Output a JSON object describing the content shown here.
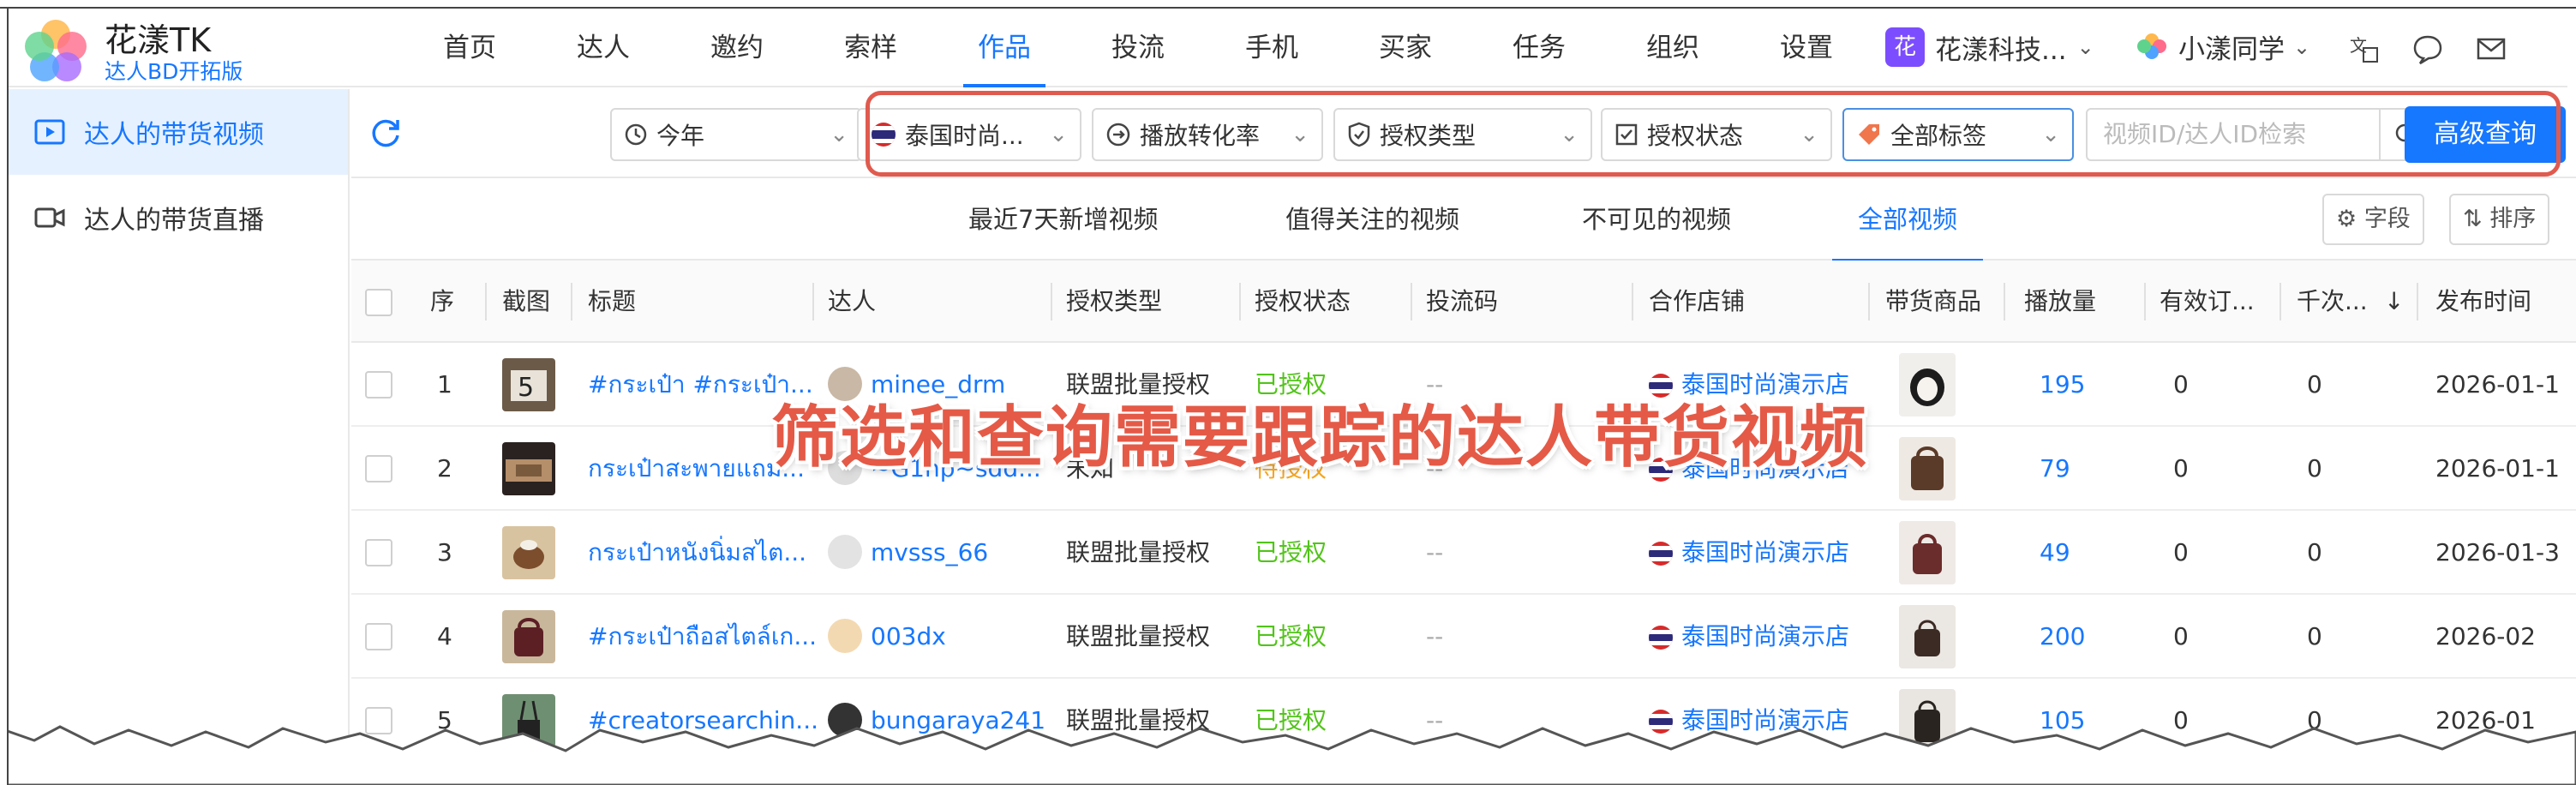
{
  "app": {
    "name": "花漾TK",
    "subtitle": "达人BD开拓版"
  },
  "nav": {
    "items": [
      "首页",
      "达人",
      "邀约",
      "索样",
      "作品",
      "投流",
      "手机",
      "买家",
      "任务",
      "组织",
      "设置"
    ],
    "active_index": 4,
    "org_badge": "花",
    "org_name": "花漾科技...",
    "user_name": "小漾同学"
  },
  "sidebar": {
    "items": [
      {
        "label": "达人的带货视频",
        "active": true
      },
      {
        "label": "达人的带货直播",
        "active": false
      }
    ]
  },
  "filters": {
    "time": "今年",
    "shop": "泰国时尚...",
    "metric": "播放转化率",
    "auth_type": "授权类型",
    "auth_status": "授权状态",
    "tags": "全部标签",
    "search_placeholder": "视频ID/达人ID检索",
    "advanced": "高级查询"
  },
  "tabs": {
    "items": [
      "最近7天新增视频",
      "值得关注的视频",
      "不可见的视频",
      "全部视频"
    ],
    "active_index": 3,
    "fields_btn": "字段",
    "sort_btn": "排序"
  },
  "table": {
    "headers": {
      "seq": "序",
      "shot": "截图",
      "title": "标题",
      "creator": "达人",
      "auth_type": "授权类型",
      "auth_status": "授权状态",
      "ad_code": "投流码",
      "shop": "合作店铺",
      "product": "带货商品",
      "plays": "播放量",
      "orders": "有效订...",
      "per_k": "千次...",
      "published": "发布时间"
    },
    "rows": [
      {
        "seq": "1",
        "title": "#กระเป๋า #กระเป๋า...",
        "creator": "minee_drm",
        "auth_type": "联盟批量授权",
        "auth_status": "已授权",
        "ad_code": "--",
        "shop": "泰国时尚演示店",
        "plays": "195",
        "orders": "0",
        "per_k": "0",
        "published": "2026-01-1"
      },
      {
        "seq": "2",
        "title": "กระเป๋าสะพายแถม...",
        "creator": "~G1np~sdd...",
        "auth_type": "未知",
        "auth_status": "待授权",
        "ad_code": "--",
        "shop": "泰国时尚演示店",
        "plays": "79",
        "orders": "0",
        "per_k": "0",
        "published": "2026-01-1"
      },
      {
        "seq": "3",
        "title": "กระเป๋าหนังนิ่มสไต...",
        "creator": "mvsss_66",
        "auth_type": "联盟批量授权",
        "auth_status": "已授权",
        "ad_code": "--",
        "shop": "泰国时尚演示店",
        "plays": "49",
        "orders": "0",
        "per_k": "0",
        "published": "2026-01-3"
      },
      {
        "seq": "4",
        "title": "#กระเป๋าถือสไตล์เก...",
        "creator": "003dx",
        "auth_type": "联盟批量授权",
        "auth_status": "已授权",
        "ad_code": "--",
        "shop": "泰国时尚演示店",
        "plays": "200",
        "orders": "0",
        "per_k": "0",
        "published": "2026-02"
      },
      {
        "seq": "5",
        "title": "#creatorsearchin...",
        "creator": "bungaraya241",
        "auth_type": "联盟批量授权",
        "auth_status": "已授权",
        "ad_code": "--",
        "shop": "泰国时尚演示店",
        "plays": "105",
        "orders": "0",
        "per_k": "0",
        "published": "2026-01"
      }
    ]
  },
  "overlay_caption": "筛选和查询需要跟踪的达人带货视频",
  "colors": {
    "accent": "#1677ff",
    "success": "#52c41a",
    "warning": "#f5a623",
    "annotation": "#e05a4e"
  }
}
